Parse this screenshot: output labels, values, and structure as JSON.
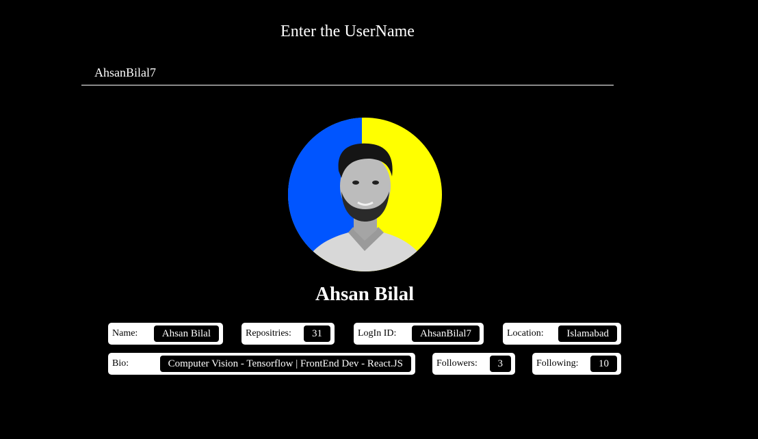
{
  "header": {
    "title": "Enter the UserName"
  },
  "search": {
    "value": "AhsanBilal7"
  },
  "profile": {
    "display_name": "Ahsan Bilal",
    "avatar_icon": "profile-photo",
    "avatar_colors": {
      "left": "#0055ff",
      "right": "#ffff00"
    }
  },
  "fields": {
    "name": {
      "label": "Name:",
      "value": "Ahsan Bilal"
    },
    "repos": {
      "label": "Repositries:",
      "value": "31"
    },
    "login": {
      "label": "LogIn ID:",
      "value": "AhsanBilal7"
    },
    "location": {
      "label": "Location:",
      "value": "Islamabad"
    },
    "bio": {
      "label": "Bio:",
      "value": "Computer Vision - Tensorflow | FrontEnd Dev - React.JS"
    },
    "followers": {
      "label": "Followers:",
      "value": "3"
    },
    "following": {
      "label": "Following:",
      "value": "10"
    }
  }
}
